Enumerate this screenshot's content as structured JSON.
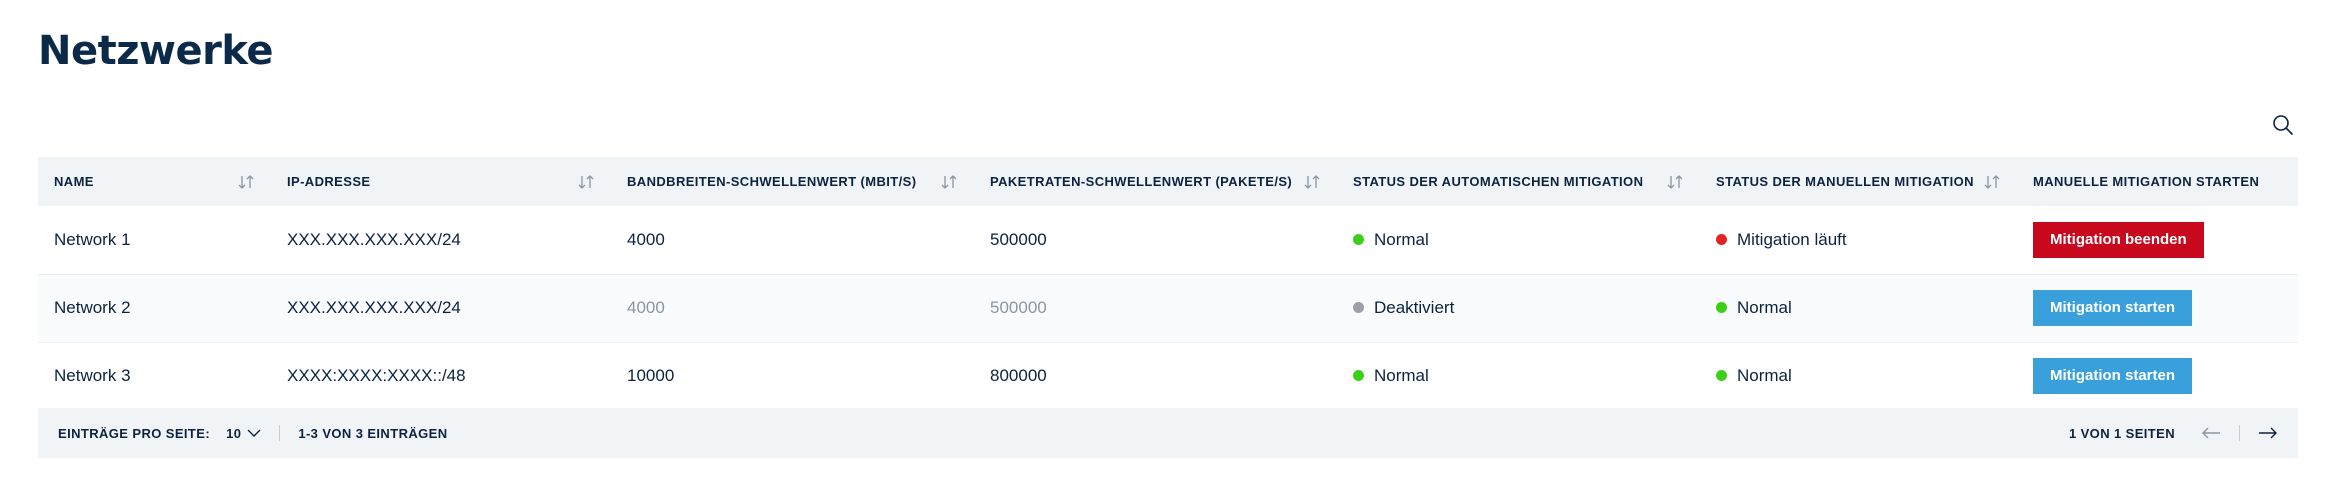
{
  "page": {
    "title": "Netzwerke"
  },
  "colors": {
    "normal": "#3ccf1a",
    "running": "#e02424",
    "disabled": "#9aa0a6",
    "btn_stop": "#c8081c",
    "btn_start": "#3aa0dc"
  },
  "table": {
    "headers": [
      "NAME",
      "IP-ADRESSE",
      "BANDBREITEN-SCHWELLENWERT (MBIT/S)",
      "PAKETRATEN-SCHWELLENWERT (PAKETE/S)",
      "STATUS DER AUTOMATISCHEN MITIGATION",
      "STATUS DER MANUELLEN MITIGATION",
      "MANUELLE MITIGATION STARTEN"
    ],
    "rows": [
      {
        "name": "Network 1",
        "ip": "XXX.XXX.XXX.XXX/24",
        "bandwidth": "4000",
        "packetrate": "500000",
        "auto_status": "Normal",
        "manual_status": "Mitigation läuft",
        "action": "Mitigation beenden"
      },
      {
        "name": "Network 2",
        "ip": "XXX.XXX.XXX.XXX/24",
        "bandwidth": "4000",
        "packetrate": "500000",
        "auto_status": "Deaktiviert",
        "manual_status": "Normal",
        "action": "Mitigation starten"
      },
      {
        "name": "Network 3",
        "ip": "XXXX:XXXX:XXXX::/48",
        "bandwidth": "10000",
        "packetrate": "800000",
        "auto_status": "Normal",
        "manual_status": "Normal",
        "action": "Mitigation starten"
      }
    ]
  },
  "footer": {
    "per_page_label": "EINTRÄGE PRO SEITE:",
    "per_page_value": "10",
    "range": "1-3 VON 3 EINTRÄGEN",
    "page_info": "1 VON 1 SEITEN"
  }
}
